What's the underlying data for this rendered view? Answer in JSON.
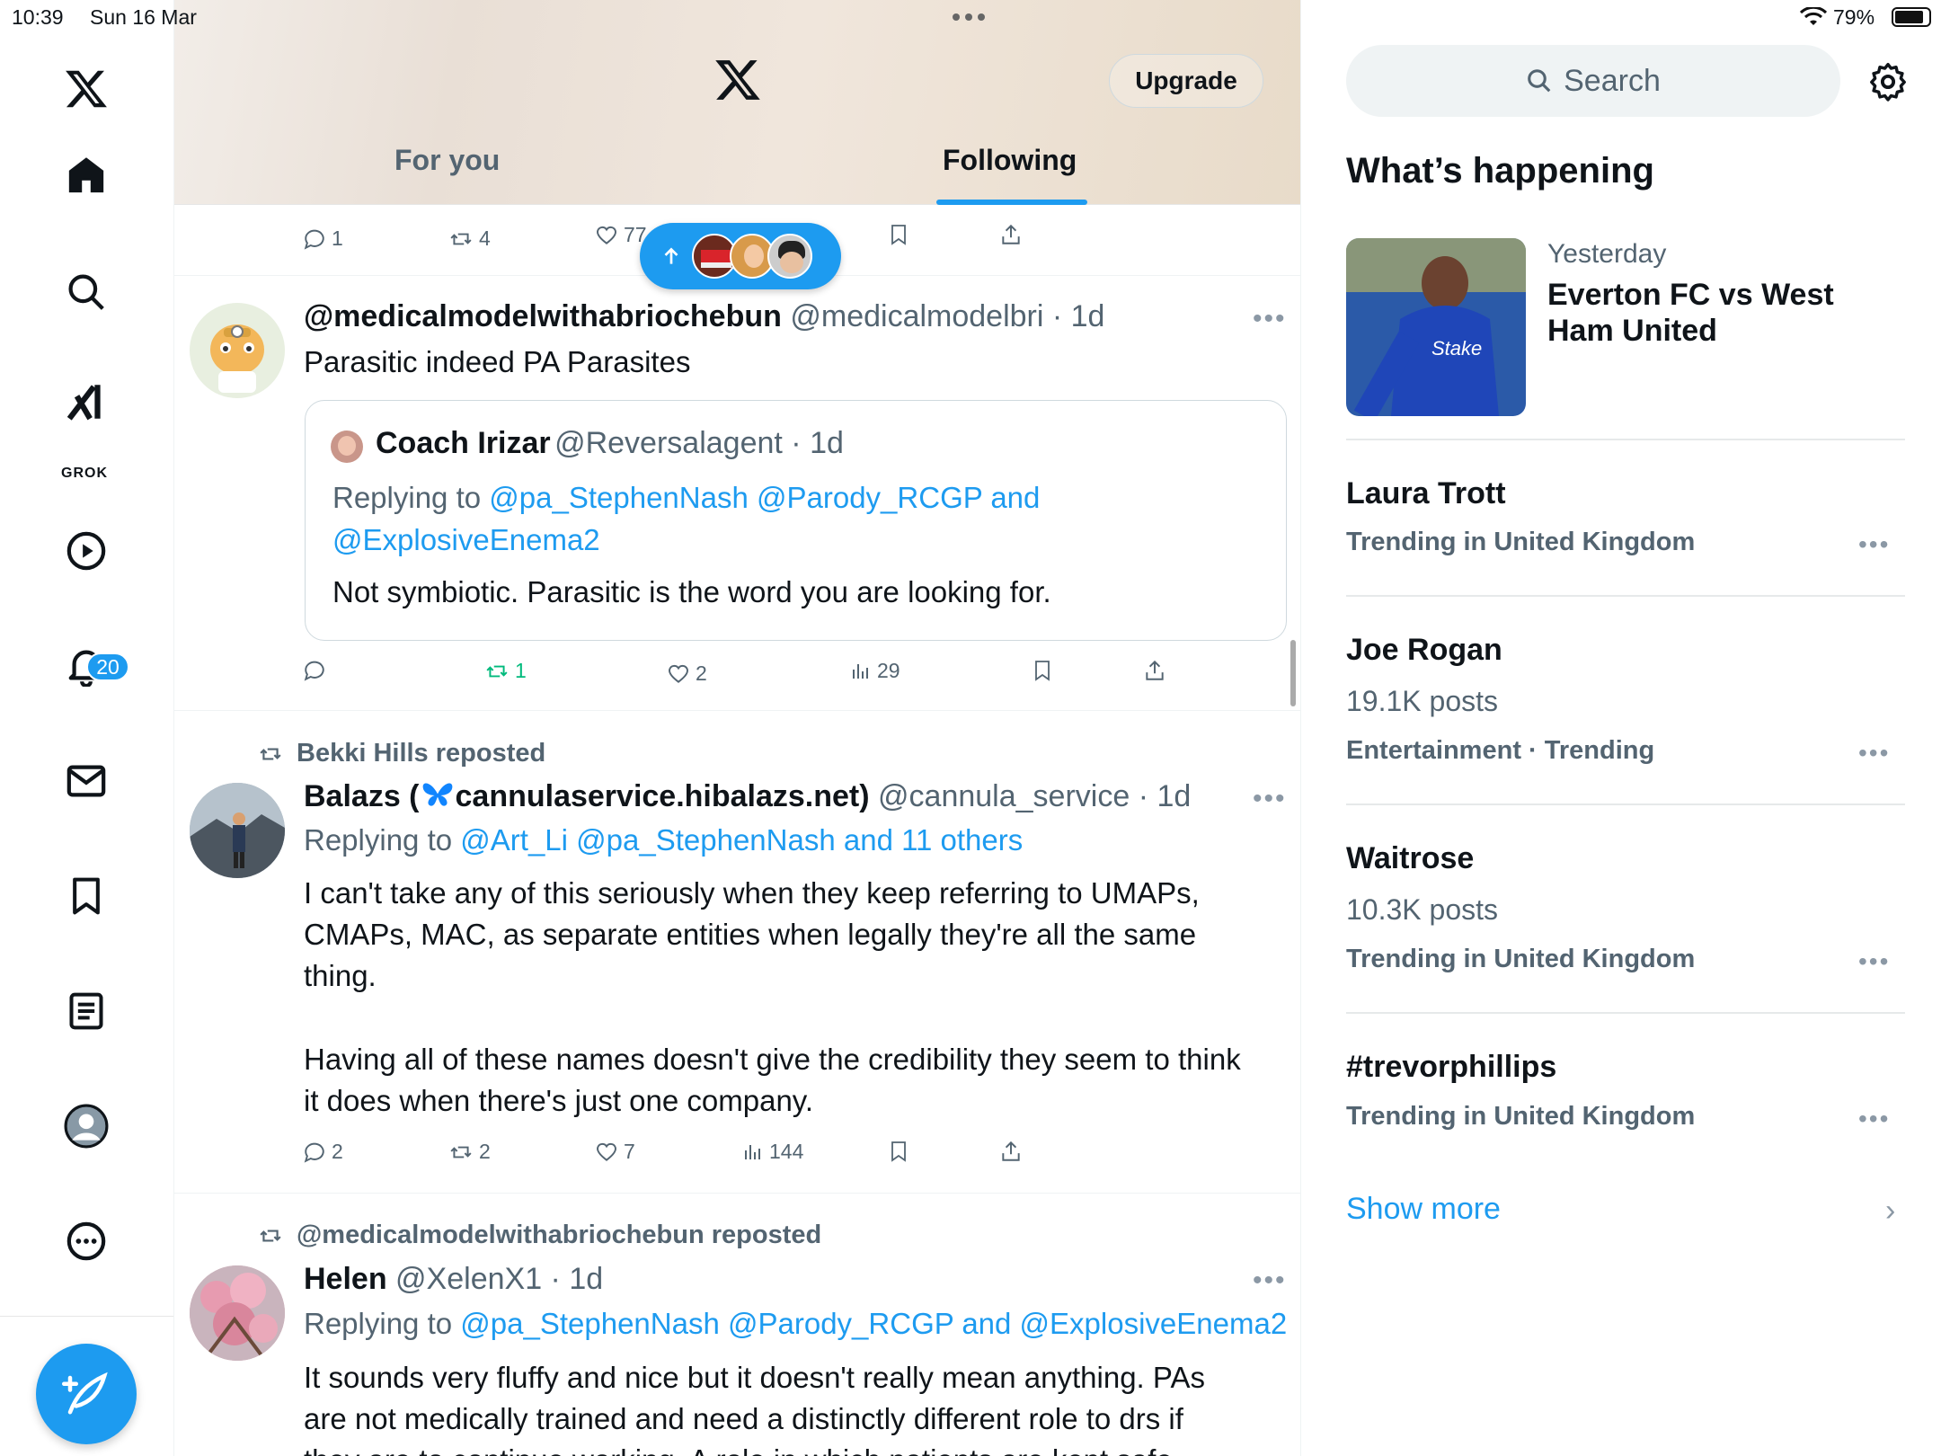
{
  "status_bar": {
    "time": "10:39",
    "date": "Sun 16 Mar",
    "battery": "79%"
  },
  "sidebar": {
    "grok_label": "GROK",
    "notifications_badge": "20",
    "items": [
      "x-logo-icon",
      "home-icon",
      "search-icon",
      "grok-icon",
      "video-icon",
      "notifications-icon",
      "messages-icon",
      "bookmarks-icon",
      "lists-icon",
      "profile-icon",
      "more-icon"
    ]
  },
  "header": {
    "upgrade_label": "Upgrade",
    "tabs": [
      {
        "label": "For you"
      },
      {
        "label": "Following",
        "active": true
      }
    ]
  },
  "feed": {
    "top_actions": {
      "replies": "1",
      "reposts": "4",
      "likes": "77"
    },
    "posts": [
      {
        "name": "@medicalmodelwithabriochebun",
        "handle": "@medicalmodelbri",
        "time": "1d",
        "text": "Parasitic indeed PA Parasites",
        "quote": {
          "name": "Coach Irizar",
          "handle": "@Reversalagent",
          "time": "1d",
          "replying_prefix": "Replying to",
          "replying_to_line1": "@pa_StephenNash @Parody_RCGP and",
          "replying_to_line2": "@ExplosiveEnema2",
          "text": "Not symbiotic. Parasitic is the word you are looking for."
        },
        "actions": {
          "replies": "",
          "reposts": "1",
          "likes": "2",
          "views": "29"
        }
      },
      {
        "repost_by": "Bekki Hills reposted",
        "name_part1": "Balazs (",
        "name_part2": "cannulaservice.hibalazs.net)",
        "handle": "@cannula_service",
        "time": "1d",
        "replying_prefix": "Replying to",
        "replying_to": "@Art_Li @pa_StephenNash and 11 others",
        "text_p1_l1": "I can't take any of this seriously when they keep referring to UMAPs,",
        "text_p1_l2": "CMAPs, MAC, as separate entities when legally they're all the same",
        "text_p1_l3": "thing.",
        "text_p2_l1": "Having all of these names doesn't give the credibility they seem to think",
        "text_p2_l2": "it does when there's just one company.",
        "actions": {
          "replies": "2",
          "reposts": "2",
          "likes": "7",
          "views": "144"
        }
      },
      {
        "repost_by": "@medicalmodelwithabriochebun reposted",
        "name": "Helen",
        "handle": "@XelenX1",
        "time": "1d",
        "replying_prefix": "Replying to",
        "replying_to": "@pa_StephenNash @Parody_RCGP and @ExplosiveEnema2",
        "text_l1": "It sounds very fluffy and nice but it doesn't really mean anything. PAs",
        "text_l2": "are not medically trained and need a distinctly different role to drs if",
        "text_l3": "they are to continue working. A role in which patients are kept safe"
      }
    ]
  },
  "right": {
    "search_placeholder": "Search",
    "heading": "What’s happening",
    "news": {
      "time": "Yesterday",
      "title": "Everton FC vs West Ham United"
    },
    "trends": [
      {
        "title": "Laura Trott",
        "count": "",
        "meta": "Trending in United Kingdom"
      },
      {
        "title": "Joe Rogan",
        "count": "19.1K posts",
        "meta": "Entertainment · Trending"
      },
      {
        "title": "Waitrose",
        "count": "10.3K posts",
        "meta": "Trending in United Kingdom"
      },
      {
        "title": "#trevorphillips",
        "count": "",
        "meta": "Trending in United Kingdom"
      }
    ],
    "show_more": "Show more"
  }
}
